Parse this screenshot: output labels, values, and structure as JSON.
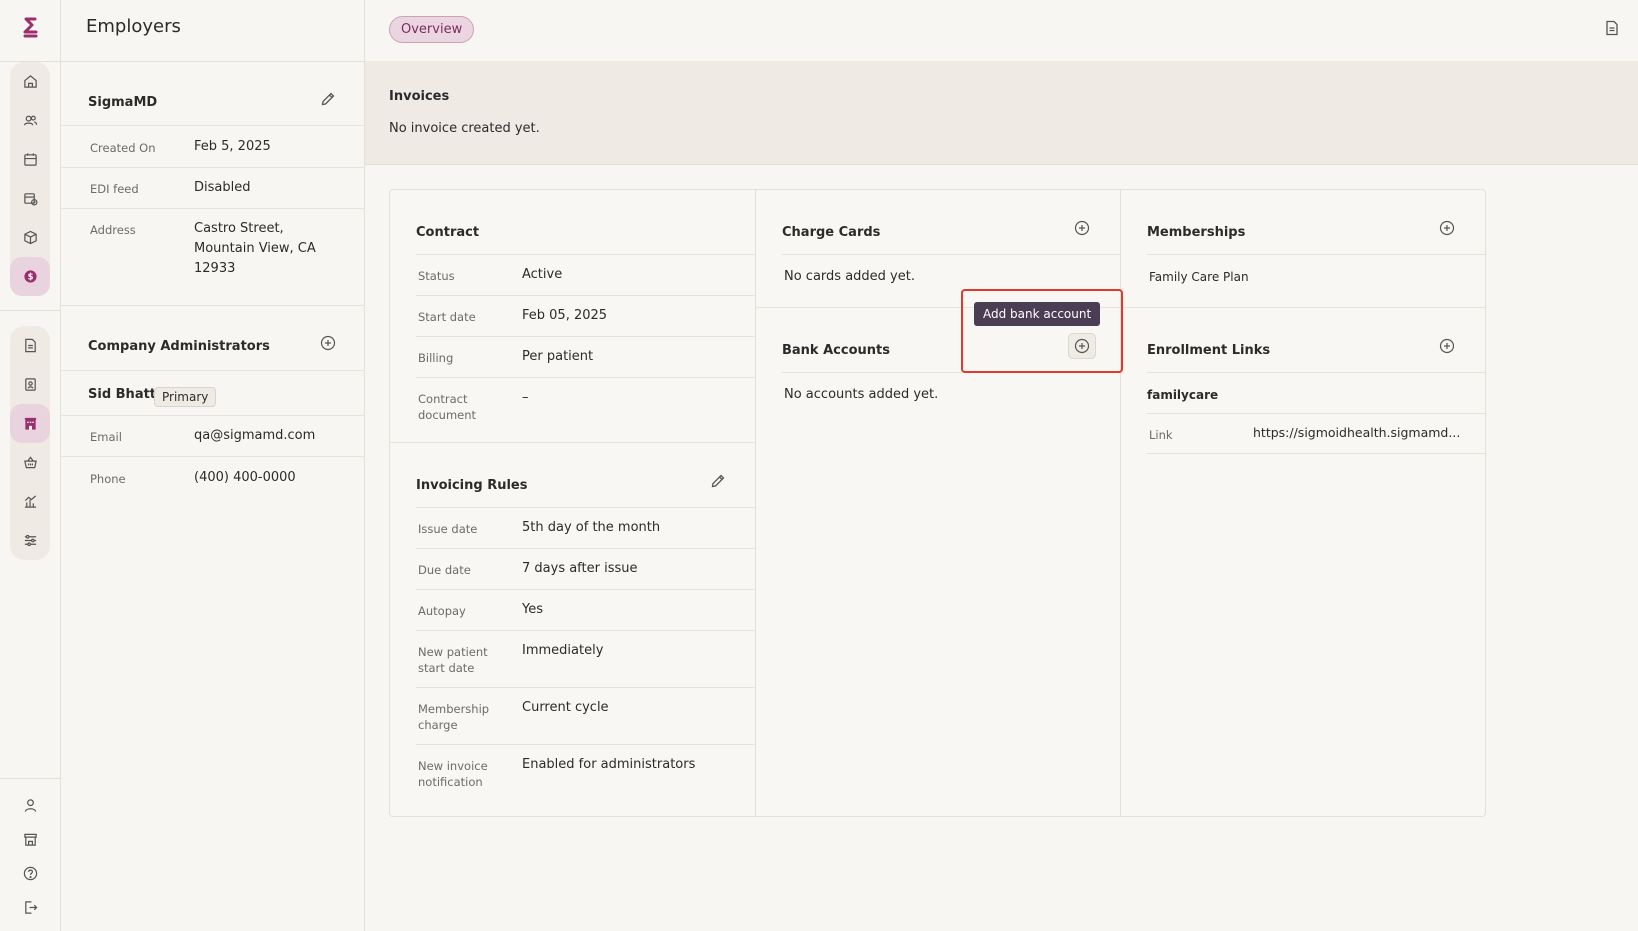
{
  "sidebar": {
    "logo_name": "app-logo",
    "group1": [
      "home-icon",
      "users-icon",
      "calendar-icon",
      "calendar-check-icon",
      "package-icon",
      "dollar-icon"
    ],
    "group2": [
      "document-icon",
      "id-card-icon",
      "building-icon",
      "basket-icon",
      "chart-icon",
      "sliders-icon"
    ],
    "bottom": [
      "user-icon",
      "store-icon",
      "help-icon",
      "logout-icon"
    ]
  },
  "pane": {
    "title": "Employers",
    "employer_name": "SigmaMD",
    "created_on_label": "Created On",
    "created_on_value": "Feb 5, 2025",
    "edi_label": "EDI feed",
    "edi_value": "Disabled",
    "address_label": "Address",
    "address_line1": "Castro Street,",
    "address_line2": "Mountain View, CA",
    "address_line3": "12933",
    "admins_title": "Company Administrators",
    "admin_name": "Sid Bhatt",
    "admin_badge": "Primary",
    "email_label": "Email",
    "email_value": "qa@sigmamd.com",
    "phone_label": "Phone",
    "phone_value": "(400) 400-0000"
  },
  "tabs": {
    "overview": "Overview"
  },
  "invoices": {
    "title": "Invoices",
    "empty": "No invoice created yet."
  },
  "contract": {
    "title": "Contract",
    "rows": [
      {
        "label": "Status",
        "value": "Active"
      },
      {
        "label": "Start date",
        "value": "Feb 05, 2025"
      },
      {
        "label": "Billing",
        "value": "Per patient"
      },
      {
        "label": "Contract",
        "label2": "document",
        "value": "–"
      }
    ]
  },
  "invoicing": {
    "title": "Invoicing Rules",
    "rows": [
      {
        "label": "Issue date",
        "value": "5th day of the month"
      },
      {
        "label": "Due date",
        "value": "7 days after issue"
      },
      {
        "label": "Autopay",
        "value": "Yes"
      },
      {
        "label": "New patient",
        "label2": "start date",
        "value": "Immediately"
      },
      {
        "label": "Membership",
        "label2": "charge",
        "value": "Current cycle"
      },
      {
        "label": "New invoice",
        "label2": "notification",
        "value": "Enabled for administrators"
      }
    ]
  },
  "charge_cards": {
    "title": "Charge Cards",
    "empty": "No cards added yet."
  },
  "bank_accounts": {
    "title": "Bank Accounts",
    "empty": "No accounts added yet.",
    "tooltip": "Add bank account"
  },
  "memberships": {
    "title": "Memberships",
    "item": "Family Care Plan"
  },
  "enrollment": {
    "title": "Enrollment Links",
    "name": "familycare",
    "link_label": "Link",
    "link_value": "https://sigmoidhealth.sigmamd..."
  },
  "colors": {
    "accent": "#9b2f6e",
    "highlight": "#e13a2a",
    "tooltip": "#4a3d54"
  }
}
